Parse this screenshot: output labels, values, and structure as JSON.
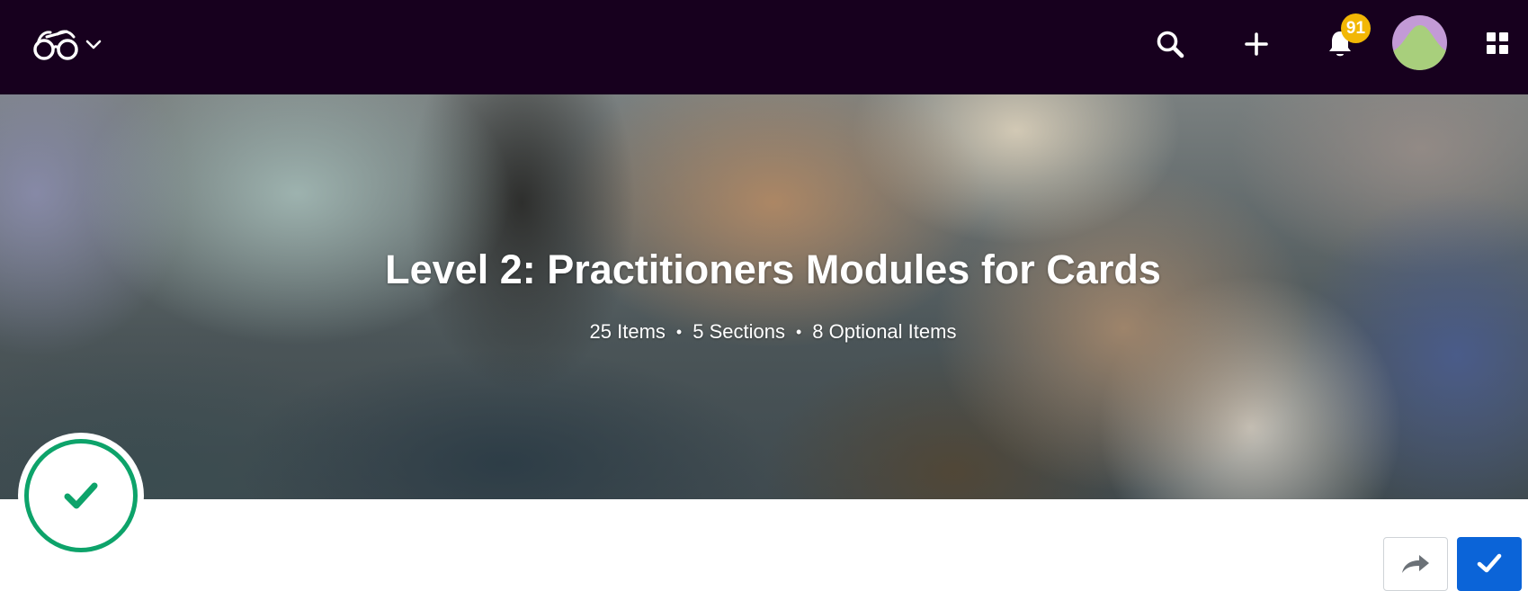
{
  "header": {
    "logo_icon": "glasses-icon",
    "logo_menu_icon": "chevron-down-icon",
    "search_icon": "search-icon",
    "add_icon": "plus-icon",
    "notifications_icon": "bell-icon",
    "notification_count": "91",
    "avatar_icon": "user-avatar",
    "apps_icon": "grid-icon",
    "colors": {
      "bar_background": "#17001e",
      "badge": "#f2b705",
      "avatar_top": "#c39ad6",
      "avatar_shape": "#a8cf7c"
    }
  },
  "hero": {
    "title": "Level 2: Practitioners Modules for Cards",
    "meta": {
      "items": "25 Items",
      "separator": "•",
      "sections": "5 Sections",
      "optional_items": "8 Optional Items"
    }
  },
  "completion": {
    "icon": "check-icon",
    "color": "#0da36a"
  },
  "actions": {
    "share_icon": "share-arrow-icon",
    "done_icon": "check-icon",
    "done_color": "#0b64d8"
  }
}
